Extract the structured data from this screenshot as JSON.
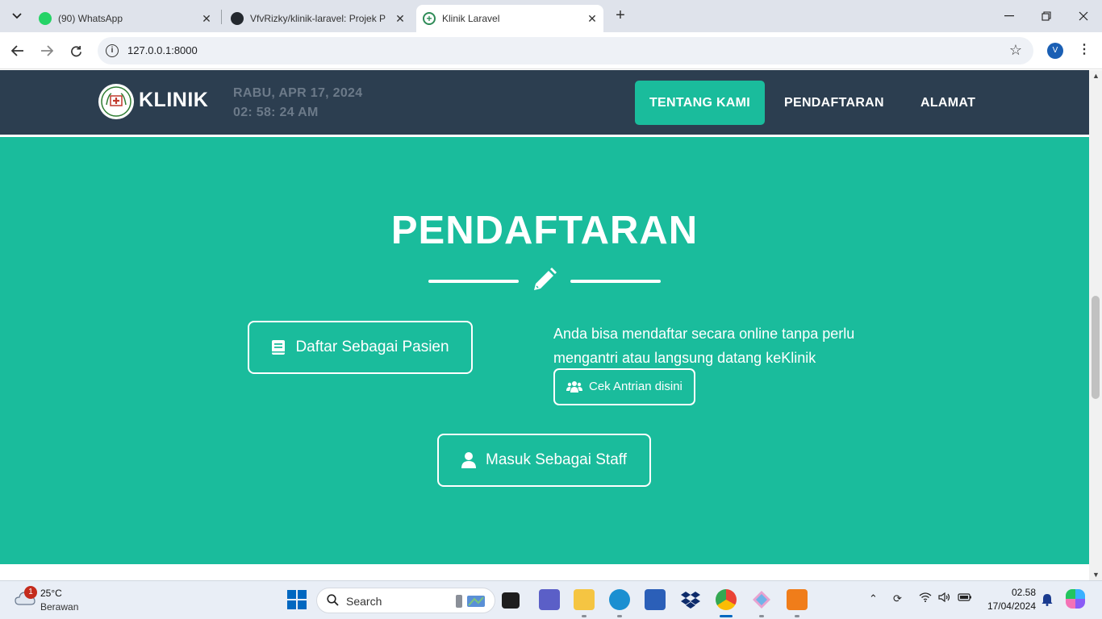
{
  "browser": {
    "tabs": [
      {
        "title": "(90) WhatsApp",
        "icon": "whatsapp-icon"
      },
      {
        "title": "VfvRizky/klinik-laravel: Projek P",
        "icon": "github-icon"
      },
      {
        "title": "Klinik Laravel",
        "icon": "klinik-icon",
        "active": true
      }
    ],
    "url": "127.0.0.1:8000",
    "profile_initial": "V"
  },
  "navbar": {
    "brand": "KLINIK",
    "date": "RABU, APR 17, 2024",
    "time": "02: 58: 24 AM",
    "links": [
      "TENTANG KAMI",
      "PENDAFTARAN",
      "ALAMAT"
    ],
    "active_link": "TENTANG KAMI"
  },
  "section": {
    "title": "PENDAFTARAN",
    "patient_button": "Daftar Sebagai Pasien",
    "info_text": "Anda bisa mendaftar secara online tanpa perlu mengantri atau langsung datang keKlinik",
    "queue_button": "Cek Antrian disini",
    "staff_button": "Masuk Sebagai Staff"
  },
  "colors": {
    "primary": "#1abc9c",
    "navbar": "#2c3e50",
    "clock": "#6c7a89"
  },
  "taskbar": {
    "weather_badge": "1",
    "temperature": "25°C",
    "condition": "Berawan",
    "search_placeholder": "Search",
    "clock_time": "02.58",
    "clock_date": "17/04/2024"
  }
}
